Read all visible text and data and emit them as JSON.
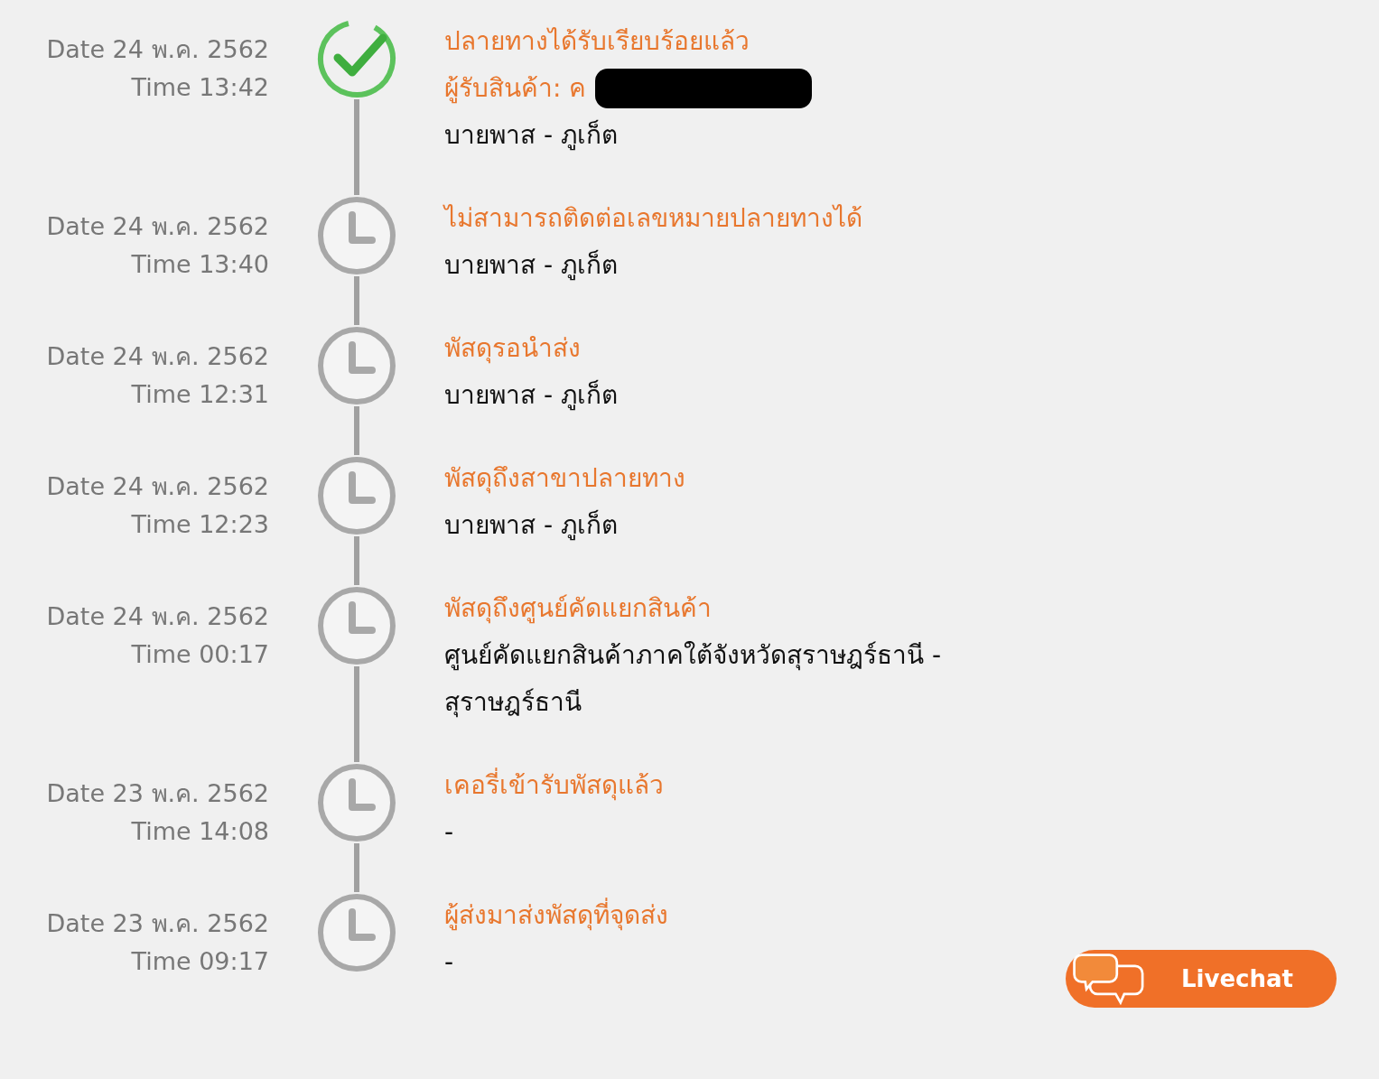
{
  "events": [
    {
      "date": "Date 24 พ.ค. 2562",
      "time": "Time 13:42",
      "kind": "delivered",
      "title": "ปลายทางได้รับเรียบร้อยแล้ว",
      "recipient": "ผู้รับสินค้า: ค",
      "location": "บายพาส - ภูเก็ต"
    },
    {
      "date": "Date 24 พ.ค. 2562",
      "time": "Time 13:40",
      "kind": "pending",
      "title": "ไม่สามารถติดต่อเลขหมายปลายทางได้",
      "location": "บายพาส - ภูเก็ต"
    },
    {
      "date": "Date 24 พ.ค. 2562",
      "time": "Time 12:31",
      "kind": "pending",
      "title": "พัสดุรอนำส่ง",
      "location": "บายพาส - ภูเก็ต"
    },
    {
      "date": "Date 24 พ.ค. 2562",
      "time": "Time 12:23",
      "kind": "pending",
      "title": "พัสดุถึงสาขาปลายทาง",
      "location": "บายพาส - ภูเก็ต"
    },
    {
      "date": "Date 24 พ.ค. 2562",
      "time": "Time 00:17",
      "kind": "pending",
      "title": "พัสดุถึงศูนย์คัดแยกสินค้า",
      "location": "ศูนย์คัดแยกสินค้าภาคใต้จังหวัดสุราษฎร์ธานี - สุราษฎร์ธานี"
    },
    {
      "date": "Date 23 พ.ค. 2562",
      "time": "Time 14:08",
      "kind": "pending",
      "title": "เคอรี่เข้ารับพัสดุแล้ว",
      "location": "-"
    },
    {
      "date": "Date 23 พ.ค. 2562",
      "time": "Time 09:17",
      "kind": "pending",
      "title": "ผู้ส่งมาส่งพัสดุที่จุดส่ง",
      "location": "-"
    }
  ],
  "livechat": {
    "label": "Livechat"
  }
}
